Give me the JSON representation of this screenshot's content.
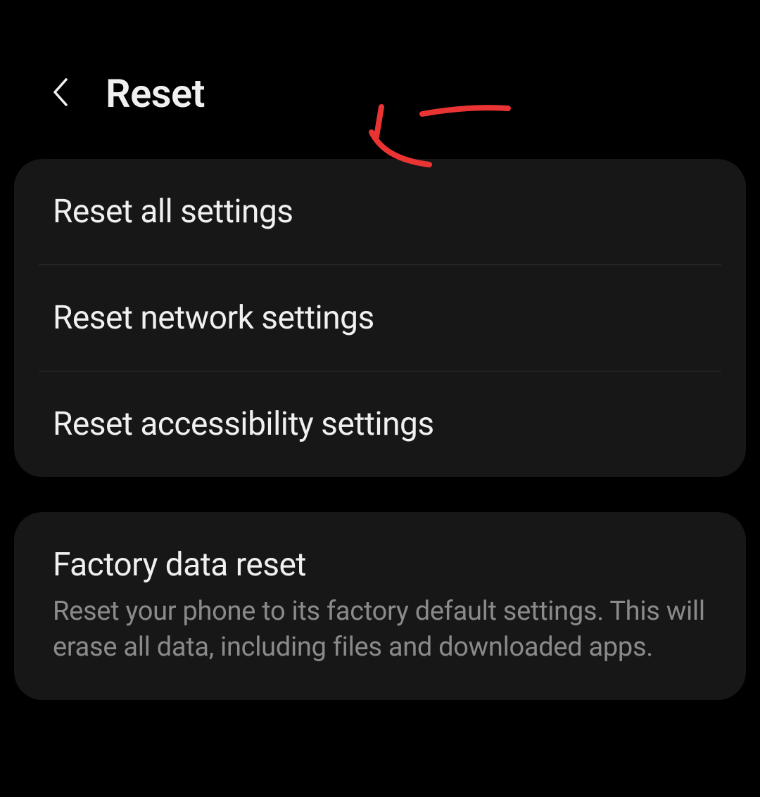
{
  "header": {
    "title": "Reset"
  },
  "groups": [
    {
      "items": [
        {
          "title": "Reset all settings"
        },
        {
          "title": "Reset network settings"
        },
        {
          "title": "Reset accessibility settings"
        }
      ]
    },
    {
      "items": [
        {
          "title": "Factory data reset",
          "subtitle": "Reset your phone to its factory default settings. This will erase all data, including files and downloaded apps."
        }
      ]
    }
  ],
  "annotation": {
    "color": "#ea3434"
  }
}
